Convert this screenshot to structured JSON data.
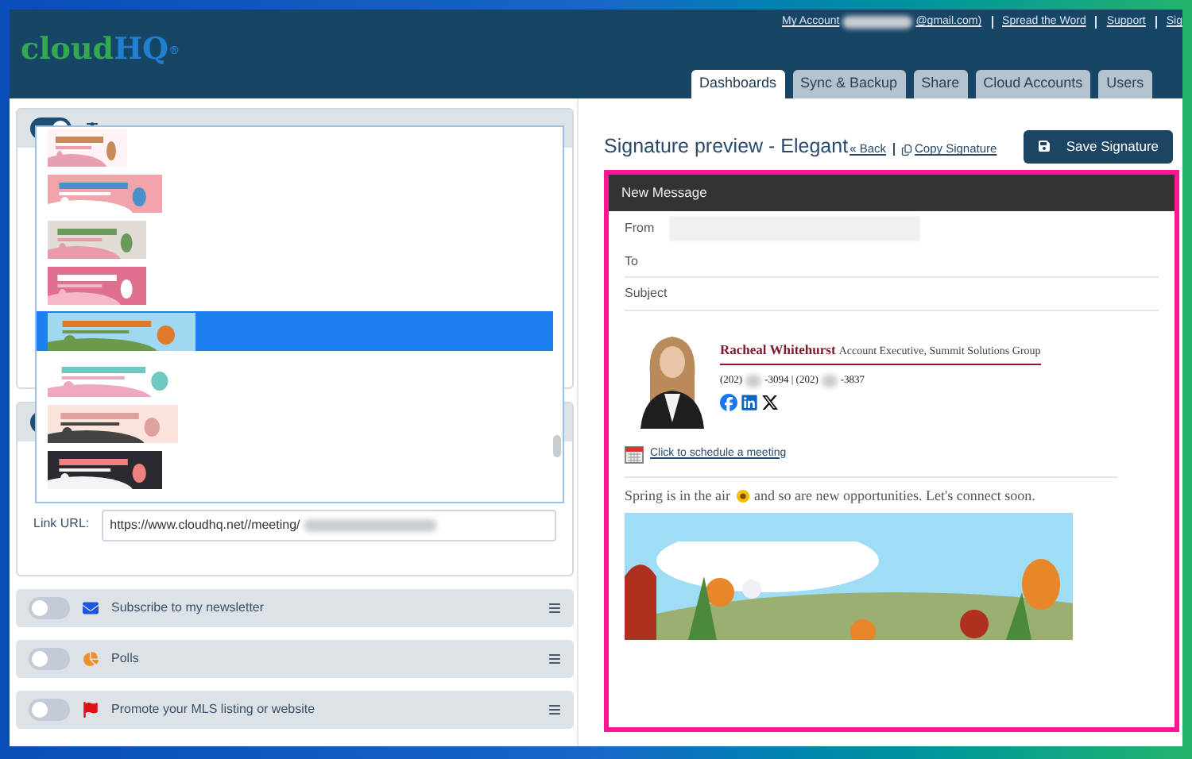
{
  "header": {
    "logo": {
      "first": "cloud",
      "second": "HQ",
      "mark": "®"
    },
    "account_label": "My Account",
    "account_email": "@gmail.com)",
    "links": [
      "Spread the Word",
      "Support",
      "Sig"
    ]
  },
  "tabs": [
    {
      "label": "Dashboards",
      "selected": true
    },
    {
      "label": "Sync & Backup",
      "selected": false
    },
    {
      "label": "Share",
      "selected": false
    },
    {
      "label": "Cloud Accounts",
      "selected": false
    },
    {
      "label": "Users",
      "selected": false
    }
  ],
  "banner_list": {
    "items": [
      {
        "kind": "picture",
        "selected": false
      },
      {
        "kind": "picture",
        "selected": false
      },
      {
        "kind": "picture",
        "selected": false
      },
      {
        "kind": "picture",
        "selected": false
      },
      {
        "kind": "picture",
        "selected": true
      },
      {
        "kind": "picture",
        "selected": false
      },
      {
        "kind": "picture",
        "selected": false
      },
      {
        "kind": "picture",
        "selected": false
      }
    ]
  },
  "cards": [
    {
      "on": true
    },
    {
      "on": true,
      "link_label": "Link URL:",
      "link_value": "https://www.cloudhq.net//meeting/"
    }
  ],
  "widgets": [
    {
      "label": "Subscribe to my newsletter",
      "on": false
    },
    {
      "label": "Polls",
      "on": false
    },
    {
      "label": "Promote your MLS listing or website",
      "on": false
    }
  ],
  "preview": {
    "title": "Signature preview - Elegant",
    "back": "« Back",
    "copy": "Copy Signature",
    "save": "Save Signature"
  },
  "compose": {
    "title": "New Message",
    "from_label": "From",
    "to_label": "To",
    "subject_label": "Subject",
    "signature": {
      "name": "Racheal Whitehurst",
      "role": "Account Executive, Summit Solutions Group",
      "phone_parts": [
        "(202)",
        "-3094 | (202)",
        "-3837"
      ],
      "meeting_link": "Click to schedule a meeting",
      "message_start": "Spring is in the air",
      "message_end": "and so are new opportunities. Let's connect soon."
    }
  }
}
